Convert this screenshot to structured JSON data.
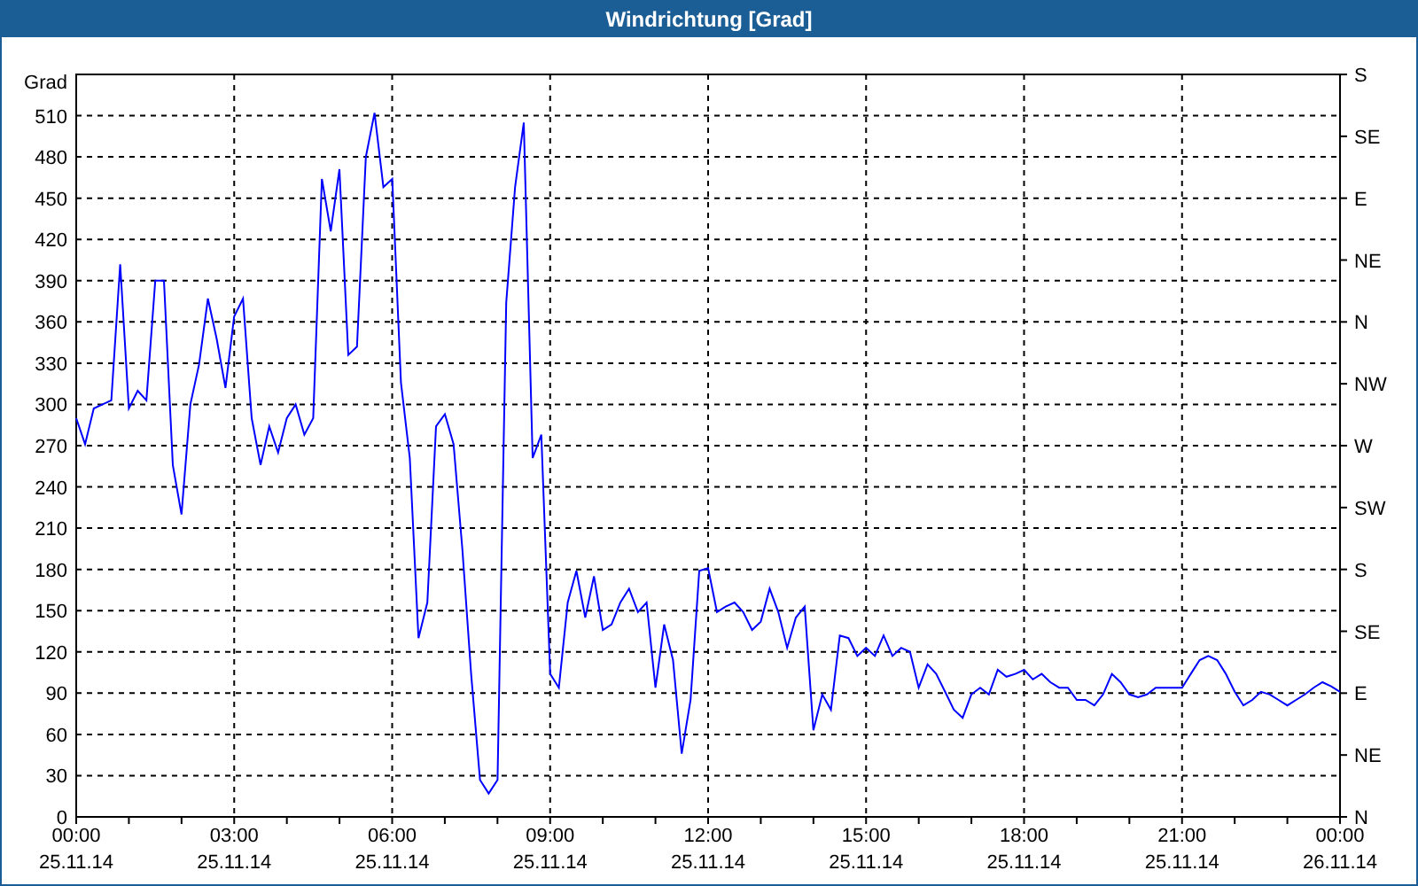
{
  "window": {
    "title": "Windrichtung [Grad]"
  },
  "chart": {
    "compass_labels": [
      "S",
      "SE",
      "E",
      "NE",
      "N",
      "NW",
      "W",
      "SW",
      "S",
      "SE",
      "E",
      "NE",
      "N"
    ],
    "chart_data": {
      "type": "line",
      "grid": true,
      "ylabel": "Grad",
      "ylim": [
        0,
        540
      ],
      "yticks": [
        0,
        30,
        60,
        90,
        120,
        150,
        180,
        210,
        240,
        270,
        300,
        330,
        360,
        390,
        420,
        450,
        480,
        510
      ],
      "categories": [
        "00:00\n25.11.14",
        null,
        null,
        null,
        null,
        null,
        null,
        null,
        null,
        null,
        null,
        null,
        null,
        null,
        null,
        null,
        null,
        null,
        "03:00\n25.11.14",
        null,
        null,
        null,
        null,
        null,
        null,
        null,
        null,
        null,
        null,
        null,
        null,
        null,
        null,
        null,
        null,
        null,
        "06:00\n25.11.14",
        null,
        null,
        null,
        null,
        null,
        null,
        null,
        null,
        null,
        null,
        null,
        null,
        null,
        null,
        null,
        null,
        null,
        "09:00\n25.11.14",
        null,
        null,
        null,
        null,
        null,
        null,
        null,
        null,
        null,
        null,
        null,
        null,
        null,
        null,
        null,
        null,
        null,
        "12:00\n25.11.14",
        null,
        null,
        null,
        null,
        null,
        null,
        null,
        null,
        null,
        null,
        null,
        null,
        null,
        null,
        null,
        null,
        null,
        "15:00\n25.11.14",
        null,
        null,
        null,
        null,
        null,
        null,
        null,
        null,
        null,
        null,
        null,
        null,
        null,
        null,
        null,
        null,
        null,
        "18:00\n25.11.14",
        null,
        null,
        null,
        null,
        null,
        null,
        null,
        null,
        null,
        null,
        null,
        null,
        null,
        null,
        null,
        null,
        null,
        "21:00\n25.11.14",
        null,
        null,
        null,
        null,
        null,
        null,
        null,
        null,
        null,
        null,
        null,
        null,
        null,
        null,
        null,
        null,
        null,
        "00:00\n26.11.14"
      ],
      "series": [
        {
          "color": "#0000ff",
          "values": [
            290,
            271,
            297,
            300,
            303,
            402,
            297,
            310,
            303,
            390,
            390,
            256,
            220,
            300,
            329,
            377,
            348,
            312,
            364,
            377,
            290,
            256,
            284,
            265,
            290,
            300,
            278,
            290,
            464,
            426,
            471,
            336,
            342,
            480,
            512,
            458,
            464,
            316,
            261,
            130,
            156,
            284,
            293,
            271,
            194,
            104,
            27,
            17,
            27,
            374,
            458,
            505,
            261,
            278,
            104,
            94,
            156,
            179,
            145,
            175,
            136,
            140,
            156,
            166,
            149,
            156,
            94,
            140,
            114,
            46,
            85,
            179,
            181,
            149,
            153,
            156,
            149,
            136,
            142,
            166,
            149,
            123,
            145,
            153,
            63,
            89,
            78,
            132,
            130,
            117,
            123,
            117,
            132,
            117,
            123,
            120,
            94,
            111,
            104,
            91,
            78,
            72,
            89,
            94,
            89,
            107,
            102,
            104,
            107,
            100,
            104,
            98,
            94,
            94,
            85,
            85,
            81,
            89,
            104,
            98,
            89,
            87,
            89,
            94,
            94,
            94,
            94,
            104,
            114,
            117,
            114,
            104,
            91,
            81,
            85,
            91,
            89,
            85,
            81,
            85,
            89,
            94,
            98,
            95,
            91
          ]
        }
      ]
    }
  }
}
